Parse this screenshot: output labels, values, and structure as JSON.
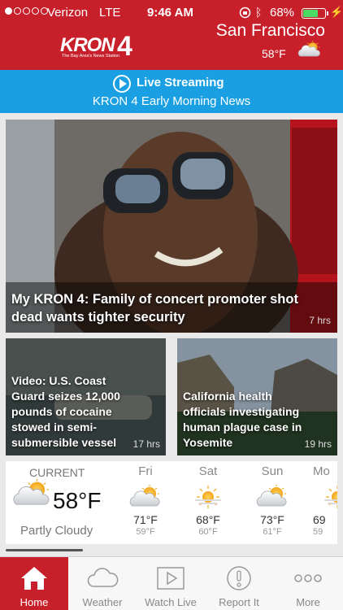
{
  "status_bar": {
    "carrier": "Verizon",
    "network": "LTE",
    "time": "9:46 AM",
    "battery": "68%",
    "battery_level": 0.68
  },
  "header": {
    "logo_text": "KRON",
    "logo_number": "4",
    "logo_tagline": "The Bay Area's News Station",
    "city": "San Francisco",
    "temperature": "58°F",
    "weather_icon": "partly-cloudy-icon",
    "colors": {
      "background": "#c8202a"
    }
  },
  "live": {
    "title": "Live Streaming",
    "program": "KRON 4 Early Morning News",
    "colors": {
      "background": "#1aa0e2"
    }
  },
  "main_story": {
    "title": "My KRON 4: Family of concert promoter shot dead wants tighter security",
    "time": "7 hrs"
  },
  "stories": [
    {
      "title": "Video: U.S. Coast Guard seizes 12,000 pounds of cocaine stowed in semi-submersible vessel",
      "time": "17 hrs"
    },
    {
      "title": "California health officials investigating human plague case in Yosemite",
      "time": "19 hrs"
    }
  ],
  "weather": {
    "current_label": "CURRENT",
    "current_temp": "58°F",
    "current_condition": "Partly Cloudy",
    "forecast": [
      {
        "day": "Fri",
        "icon": "partly-cloudy-icon",
        "high": "71°F",
        "low": "59°F"
      },
      {
        "day": "Sat",
        "icon": "sunny-icon",
        "high": "68°F",
        "low": "60°F"
      },
      {
        "day": "Sun",
        "icon": "partly-cloudy-icon",
        "high": "73°F",
        "low": "61°F"
      },
      {
        "day": "Mo",
        "icon": "sunny-icon",
        "high": "69",
        "low": "59"
      }
    ]
  },
  "tabs": [
    {
      "label": "Home",
      "icon": "home-icon"
    },
    {
      "label": "Weather",
      "icon": "cloud-icon"
    },
    {
      "label": "Watch Live",
      "icon": "play-icon"
    },
    {
      "label": "Report It",
      "icon": "alert-icon"
    },
    {
      "label": "More",
      "icon": "more-icon"
    }
  ]
}
